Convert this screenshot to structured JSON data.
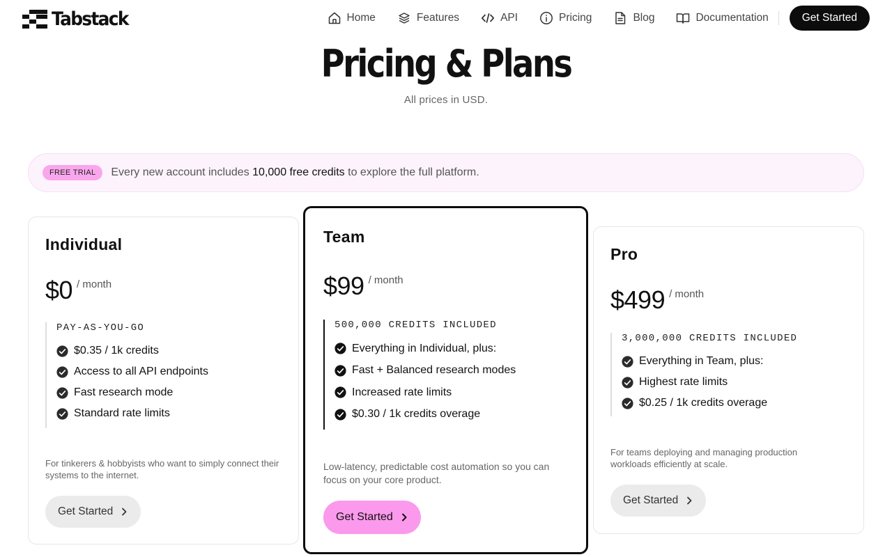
{
  "brand": {
    "name": "Tabstack"
  },
  "nav": {
    "items": [
      {
        "label": "Home",
        "icon": "home-icon"
      },
      {
        "label": "Features",
        "icon": "layers-icon"
      },
      {
        "label": "API",
        "icon": "code-icon"
      },
      {
        "label": "Pricing",
        "icon": "info-icon"
      },
      {
        "label": "Blog",
        "icon": "document-icon"
      },
      {
        "label": "Documentation",
        "icon": "book-icon"
      }
    ],
    "cta": "Get Started"
  },
  "page": {
    "title": "Pricing & Plans",
    "subtitle": "All prices in USD."
  },
  "banner": {
    "badge": "FREE TRIAL",
    "text_before": "Every new account includes ",
    "text_strong": "10,000 free credits",
    "text_after": " to explore the full platform."
  },
  "plans": [
    {
      "name": "Individual",
      "price": "$0",
      "period": "/ month",
      "features_head": "PAY-AS-YOU-GO",
      "features": [
        "$0.35 / 1k credits",
        "Access to all API endpoints",
        "Fast research mode",
        "Standard rate limits"
      ],
      "description": "For tinkerers & hobbyists who want to simply connect their systems to the internet.",
      "button": "Get Started"
    },
    {
      "name": "Team",
      "price": "$99",
      "period": "/ month",
      "features_head": "500,000 CREDITS INCLUDED",
      "features": [
        "Everything in Individual, plus:",
        "Fast + Balanced research modes",
        "Increased rate limits",
        "$0.30 / 1k credits overage"
      ],
      "description": "Low-latency, predictable cost automation so you can focus on your core product.",
      "button": "Get Started"
    },
    {
      "name": "Pro",
      "price": "$499",
      "period": "/ month",
      "features_head": "3,000,000 CREDITS INCLUDED",
      "features": [
        "Everything in Team, plus:",
        "Highest rate limits",
        "$0.25 / 1k credits overage"
      ],
      "description": "For teams deploying and managing production workloads efficiently at scale.",
      "button": "Get Started"
    }
  ],
  "colors": {
    "accent_pink": "#fb99ec",
    "banner_bg": "#fdf3fc",
    "dark": "#0c0c0c"
  }
}
